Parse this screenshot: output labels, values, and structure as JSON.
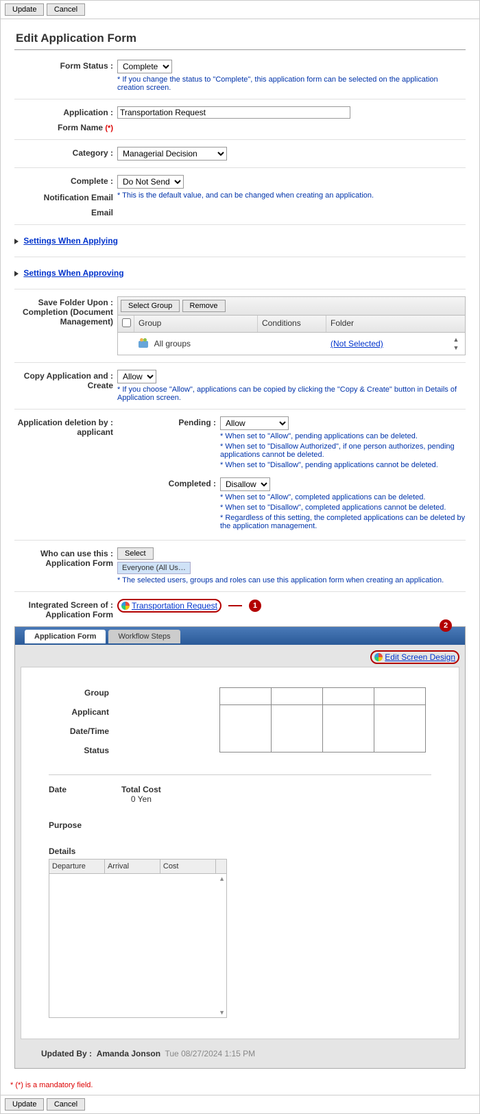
{
  "buttons": {
    "update": "Update",
    "cancel": "Cancel",
    "select_group": "Select Group",
    "remove": "Remove",
    "select": "Select"
  },
  "page_title": "Edit Application Form",
  "fields": {
    "form_status": {
      "label": "Form Status :",
      "value": "Complete",
      "hint": "* If you change the status to \"Complete\", this application form can be selected on the application creation screen."
    },
    "application": {
      "label": "Application :",
      "value": "Transportation Request"
    },
    "form_name": {
      "label": "Form Name",
      "req": "(*)"
    },
    "category": {
      "label": "Category :",
      "value": "Managerial Decision"
    },
    "complete": {
      "label": "Complete :",
      "value": "Do Not Send"
    },
    "notification_email": {
      "label": "Notification Email",
      "hint": "* This is the default value, and can be changed when creating an application."
    },
    "settings_applying": "Settings When Applying",
    "settings_approving": "Settings When Approving",
    "save_folder": {
      "label1": "Save Folder Upon :",
      "label2": "Completion (Document",
      "label3": "Management)"
    },
    "copy_app": {
      "label1": "Copy Application and :",
      "label2": "Create",
      "value": "Allow",
      "hint": "* If you choose \"Allow\", applications can be copied by clicking the \"Copy & Create\" button in Details of Application screen."
    },
    "deletion": {
      "label1": "Application deletion by :",
      "label2": "applicant",
      "pending": {
        "label": "Pending :",
        "value": "Allow",
        "hint1": "* When set to \"Allow\", pending applications can be deleted.",
        "hint2": "* When set to \"Disallow Authorized\", if one person authorizes, pending applications cannot be deleted.",
        "hint3": "* When set to \"Disallow\", pending applications cannot be deleted."
      },
      "completed": {
        "label": "Completed :",
        "value": "Disallow",
        "hint1": "* When set to \"Allow\", completed applications can be deleted.",
        "hint2": "* When set to \"Disallow\", completed applications cannot be deleted.",
        "hint3": "* Regardless of this setting, the completed applications can be deleted by the application management."
      }
    },
    "who_can_use": {
      "label1": "Who can use this :",
      "label2": "Application Form",
      "chip": "Everyone (All Us…",
      "hint": "* The selected users, groups and roles can use this application form when creating an application."
    },
    "integrated": {
      "label1": "Integrated Screen of :",
      "label2": "Application Form",
      "link": "Transportation Request"
    }
  },
  "table": {
    "col_group": "Group",
    "col_conditions": "Conditions",
    "col_folder": "Folder",
    "row_group": "All groups",
    "row_folder": "(Not Selected)"
  },
  "callout1": "1",
  "callout2": "2",
  "tabs": {
    "form": "Application Form",
    "workflow": "Workflow Steps",
    "edit_link": "Edit Screen Design"
  },
  "preview": {
    "group": "Group",
    "applicant": "Applicant",
    "datetime": "Date/Time",
    "status": "Status",
    "date": "Date",
    "total_cost": "Total Cost",
    "total_cost_value": "0 Yen",
    "purpose": "Purpose",
    "details": "Details",
    "col_departure": "Departure",
    "col_arrival": "Arrival",
    "col_cost": "Cost"
  },
  "updated_by": {
    "label": "Updated By :",
    "name": "Amanda Jonson",
    "date": "Tue 08/27/2024 1:15 PM"
  },
  "mandatory_note": "* (*) is a mandatory field."
}
